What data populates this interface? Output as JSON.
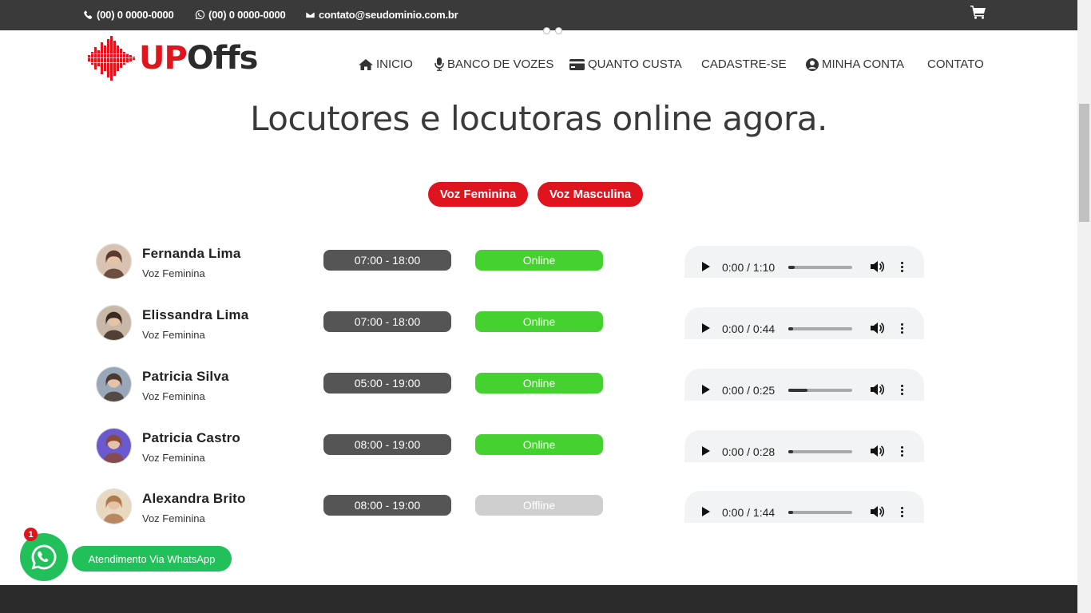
{
  "topbar": {
    "phone": "(00) 0 0000-0000",
    "whatsapp": "(00) 0 0000-0000",
    "email": "contato@seudominio.com.br"
  },
  "logo": {
    "part1": "UP",
    "part2": "Offs"
  },
  "nav": [
    {
      "label": "INICIO",
      "icon": "home-icon"
    },
    {
      "label": "BANCO DE VOZES",
      "icon": "microphone-icon"
    },
    {
      "label": "QUANTO CUSTA",
      "icon": "credit-card-icon"
    },
    {
      "label": "CADASTRE-SE",
      "icon": ""
    },
    {
      "label": "MINHA CONTA",
      "icon": "user-circle-icon"
    },
    {
      "label": "CONTATO",
      "icon": ""
    }
  ],
  "page_title": "Locutores e locutoras online agora.",
  "filters": {
    "female": "Voz Feminina",
    "male": "Voz Masculina"
  },
  "colors": {
    "brand_red": "#e0141e",
    "online_green": "#45d12f",
    "offline_gray": "#cfcfcf",
    "hours_gray": "#555555",
    "whatsapp_green": "#22c05a"
  },
  "voices": [
    {
      "name": "Fernanda Lima",
      "type": "Voz Feminina",
      "hours": "07:00 - 18:00",
      "status": "Online",
      "online": true,
      "time": "0:00 / 1:10",
      "progress": 0.1
    },
    {
      "name": "Elissandra Lima",
      "type": "Voz Feminina",
      "hours": "07:00 - 18:00",
      "status": "Online",
      "online": true,
      "time": "0:00 / 0:44",
      "progress": 0.08
    },
    {
      "name": "Patricia Silva",
      "type": "Voz Feminina",
      "hours": "05:00 - 19:00",
      "status": "Online",
      "online": true,
      "time": "0:00 / 0:25",
      "progress": 0.3
    },
    {
      "name": "Patricia Castro",
      "type": "Voz Feminina",
      "hours": "08:00 - 19:00",
      "status": "Online",
      "online": true,
      "time": "0:00 / 0:28",
      "progress": 0.08
    },
    {
      "name": "Alexandra Brito",
      "type": "Voz Feminina",
      "hours": "08:00 - 19:00",
      "status": "Offline",
      "online": false,
      "time": "0:00 / 1:44",
      "progress": 0.02
    }
  ],
  "whatsapp": {
    "badge": "1",
    "label": "Atendimento Via WhatsApp"
  }
}
